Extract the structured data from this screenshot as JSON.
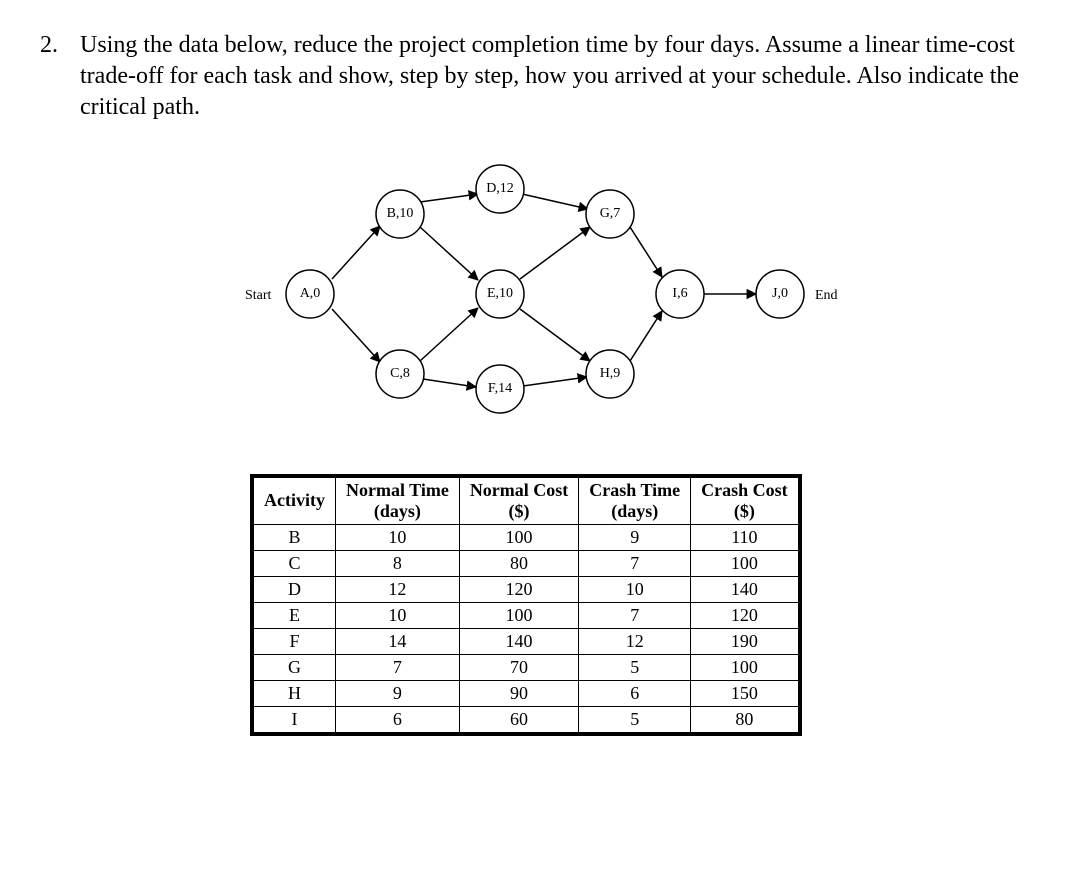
{
  "question": {
    "number": "2.",
    "text": "Using the data below, reduce the project completion time by four days. Assume a linear time-cost trade-off for each task and show, step by step, how you arrived at your schedule.  Also indicate the critical path."
  },
  "diagram": {
    "start_label": "Start",
    "end_label": "End",
    "nodes": {
      "A": "A,0",
      "B": "B,10",
      "C": "C,8",
      "D": "D,12",
      "E": "E,10",
      "F": "F,14",
      "G": "G,7",
      "H": "H,9",
      "I": "I,6",
      "J": "J,0"
    }
  },
  "table": {
    "headers": {
      "activity": "Activity",
      "normal_time": "Normal Time (days)",
      "normal_cost": "Normal Cost ($)",
      "crash_time": "Crash Time (days)",
      "crash_cost": "Crash Cost ($)"
    },
    "rows": [
      {
        "activity": "B",
        "nt": "10",
        "nc": "100",
        "ct": "9",
        "cc": "110"
      },
      {
        "activity": "C",
        "nt": "8",
        "nc": "80",
        "ct": "7",
        "cc": "100"
      },
      {
        "activity": "D",
        "nt": "12",
        "nc": "120",
        "ct": "10",
        "cc": "140"
      },
      {
        "activity": "E",
        "nt": "10",
        "nc": "100",
        "ct": "7",
        "cc": "120"
      },
      {
        "activity": "F",
        "nt": "14",
        "nc": "140",
        "ct": "12",
        "cc": "190"
      },
      {
        "activity": "G",
        "nt": "7",
        "nc": "70",
        "ct": "5",
        "cc": "100"
      },
      {
        "activity": "H",
        "nt": "9",
        "nc": "90",
        "ct": "6",
        "cc": "150"
      },
      {
        "activity": "I",
        "nt": "6",
        "nc": "60",
        "ct": "5",
        "cc": "80"
      }
    ]
  },
  "chart_data": {
    "type": "table",
    "title": "Project Crashing Data with Activity Network",
    "network": {
      "nodes": [
        "A",
        "B",
        "C",
        "D",
        "E",
        "F",
        "G",
        "H",
        "I",
        "J"
      ],
      "durations": {
        "A": 0,
        "B": 10,
        "C": 8,
        "D": 12,
        "E": 10,
        "F": 14,
        "G": 7,
        "H": 9,
        "I": 6,
        "J": 0
      },
      "edges": [
        [
          "Start",
          "A"
        ],
        [
          "A",
          "B"
        ],
        [
          "A",
          "C"
        ],
        [
          "B",
          "D"
        ],
        [
          "B",
          "E"
        ],
        [
          "C",
          "E"
        ],
        [
          "C",
          "F"
        ],
        [
          "D",
          "G"
        ],
        [
          "E",
          "G"
        ],
        [
          "E",
          "H"
        ],
        [
          "F",
          "H"
        ],
        [
          "G",
          "I"
        ],
        [
          "H",
          "I"
        ],
        [
          "I",
          "J"
        ],
        [
          "J",
          "End"
        ]
      ]
    },
    "columns": [
      "Activity",
      "Normal Time (days)",
      "Normal Cost ($)",
      "Crash Time (days)",
      "Crash Cost ($)"
    ],
    "data": [
      [
        "B",
        10,
        100,
        9,
        110
      ],
      [
        "C",
        8,
        80,
        7,
        100
      ],
      [
        "D",
        12,
        120,
        10,
        140
      ],
      [
        "E",
        10,
        100,
        7,
        120
      ],
      [
        "F",
        14,
        140,
        12,
        190
      ],
      [
        "G",
        7,
        70,
        5,
        100
      ],
      [
        "H",
        9,
        90,
        6,
        150
      ],
      [
        "I",
        6,
        60,
        5,
        80
      ]
    ]
  }
}
